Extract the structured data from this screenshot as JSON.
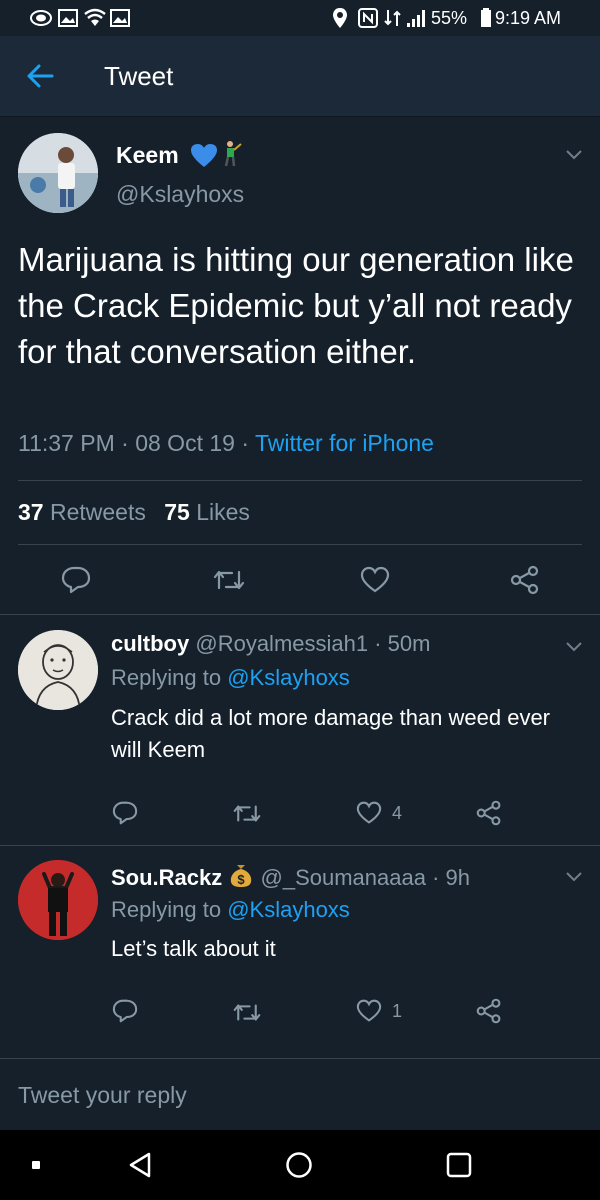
{
  "status_bar": {
    "battery": "55%",
    "time": "9:19 AM",
    "icons": [
      "nfc-icon",
      "wifi-icon",
      "signal-icon",
      "battery-icon",
      "location-icon"
    ]
  },
  "header": {
    "back_icon": "arrow-left-icon",
    "title": "Tweet"
  },
  "tweet": {
    "author_name": "Keem",
    "author_emojis": [
      "blue-heart-icon",
      "golfer-icon"
    ],
    "author_handle": "@Kslayhoxs",
    "text": "Marijuana is hitting our generation like the Crack Epidemic but y’all not ready for that conversation either.",
    "time": "11:37 PM",
    "date": "08 Oct 19",
    "source": "Twitter for iPhone",
    "retweets_count": "37",
    "retweets_label": "Retweets",
    "likes_count": "75",
    "likes_label": "Likes"
  },
  "replies": [
    {
      "name": "cultboy",
      "handle": "@Royalmessiah1",
      "age": "50m",
      "replying_prefix": "Replying to",
      "replying_to": "@Kslayhoxs",
      "text": "Crack did a lot more damage than weed ever will Keem",
      "likes": "4"
    },
    {
      "name": "Sou.Rackz",
      "badge_icon": "money-bag-icon",
      "handle": "@_Soumanaaaa",
      "age": "9h",
      "replying_prefix": "Replying to",
      "replying_to": "@Kslayhoxs",
      "text": "Let’s talk about it",
      "likes": "1"
    }
  ],
  "composer": {
    "placeholder": "Tweet your reply"
  },
  "nav": {
    "icons": [
      "recent-apps-icon",
      "back-icon",
      "home-icon",
      "overview-icon"
    ]
  },
  "colors": {
    "background": "#15202b",
    "header_bg": "#1c2938",
    "accent": "#1da1f2",
    "muted": "#8899a6",
    "divider": "#38444d"
  }
}
